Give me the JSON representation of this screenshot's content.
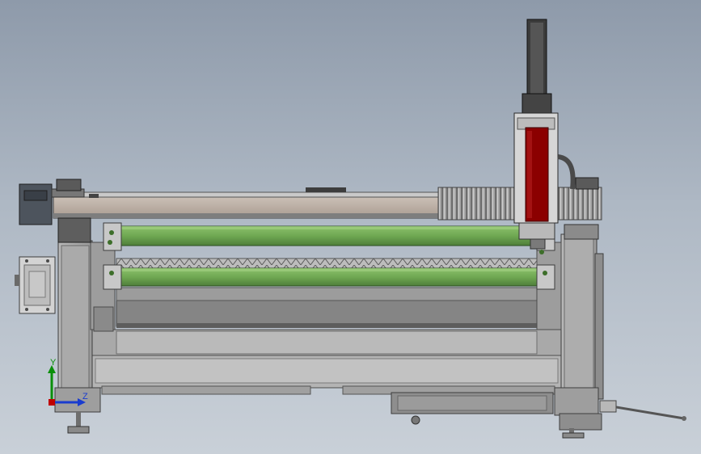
{
  "viewport": {
    "background_top": "#8e9aaa",
    "background_bottom": "#c9d0d8"
  },
  "colors": {
    "frame_gray": "#a7a7a7",
    "frame_dark": "#6f6f6f",
    "beam_tan": "#b9ada3",
    "roller_green": "#6fa852",
    "roller_green_dark": "#3f6b2d",
    "cutter_red": "#8b0000",
    "bellows_gray": "#9b9b9b",
    "rail_gray": "#c4c4c4",
    "motor_dark": "#4a4f57"
  },
  "triad": {
    "x_label": "",
    "y_label": "Y",
    "z_label": "Z",
    "icons": [
      "y-axis-arrow-icon",
      "z-axis-arrow-icon",
      "x-axis-origin-icon"
    ]
  }
}
